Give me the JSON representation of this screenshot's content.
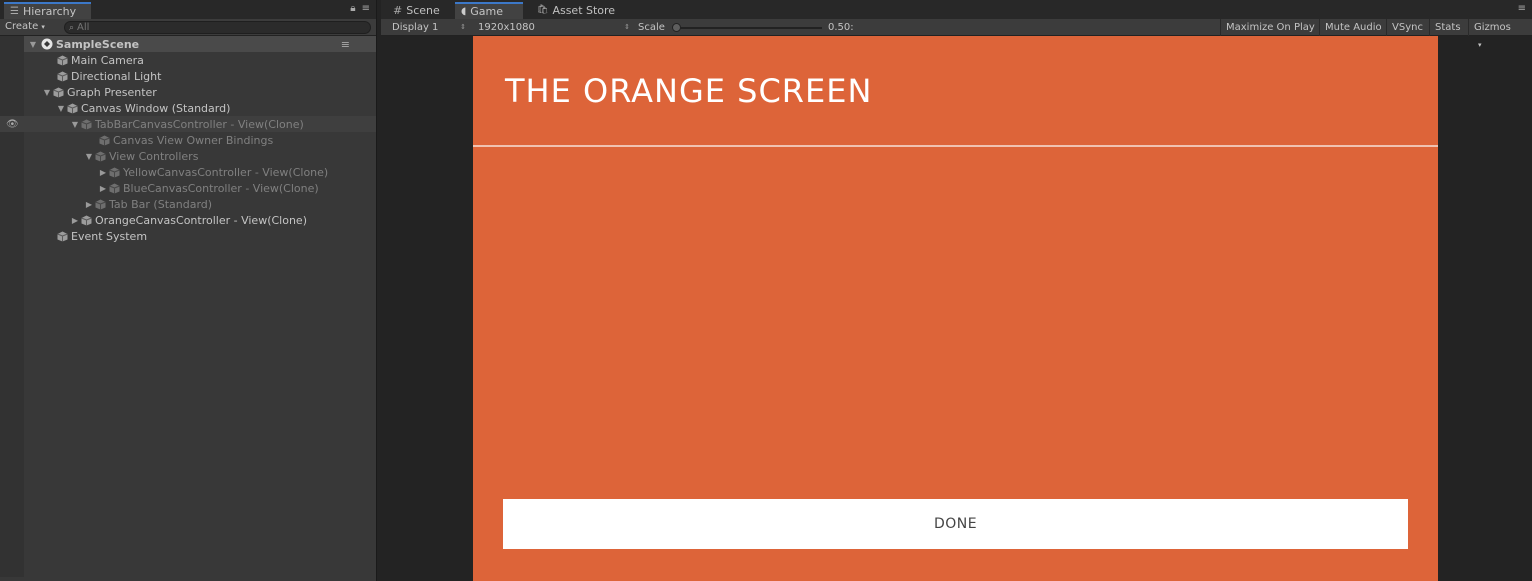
{
  "hierarchy": {
    "tab_label": "Hierarchy",
    "create_label": "Create",
    "search_placeholder": "All",
    "scene_name": "SampleScene",
    "items": [
      {
        "label": "Main Camera"
      },
      {
        "label": "Directional Light"
      },
      {
        "label": "Graph Presenter"
      },
      {
        "label": "Canvas Window (Standard)"
      },
      {
        "label": "TabBarCanvasController - View(Clone)"
      },
      {
        "label": "Canvas View Owner Bindings"
      },
      {
        "label": "View Controllers"
      },
      {
        "label": "YellowCanvasController - View(Clone)"
      },
      {
        "label": "BlueCanvasController - View(Clone)"
      },
      {
        "label": "Tab Bar (Standard)"
      },
      {
        "label": "OrangeCanvasController - View(Clone)"
      },
      {
        "label": "Event System"
      }
    ]
  },
  "gameview": {
    "tabs": [
      {
        "label": "Scene"
      },
      {
        "label": "Game"
      },
      {
        "label": "Asset Store"
      }
    ],
    "display_label": "Display 1",
    "resolution_label": "1920x1080",
    "scale_label": "Scale",
    "scale_value": "0.50:",
    "buttons": {
      "maximize": "Maximize On Play",
      "mute": "Mute Audio",
      "vsync": "VSync",
      "stats": "Stats",
      "gizmos": "Gizmos"
    }
  },
  "orange_screen": {
    "title": "THE ORANGE SCREEN",
    "done_label": "DONE",
    "bg_color": "#dd6439"
  }
}
